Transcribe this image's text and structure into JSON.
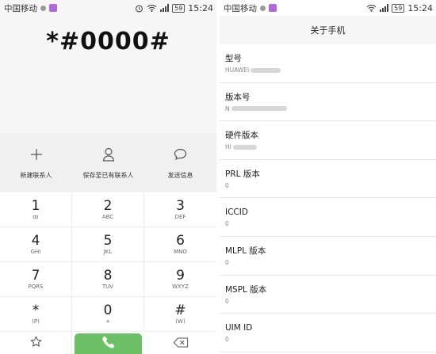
{
  "status_bar": {
    "carrier": "中国移动",
    "battery": "59",
    "time": "15:24"
  },
  "dialer": {
    "input": "*#0000#",
    "actions": [
      {
        "label": "新建联系人",
        "icon": "plus-icon"
      },
      {
        "label": "保存至已有联系人",
        "icon": "person-icon"
      },
      {
        "label": "发送信息",
        "icon": "message-icon"
      }
    ],
    "keys": [
      {
        "digit": "1",
        "letters": "ꝏ"
      },
      {
        "digit": "2",
        "letters": "ABC"
      },
      {
        "digit": "3",
        "letters": "DEF"
      },
      {
        "digit": "4",
        "letters": "GHI"
      },
      {
        "digit": "5",
        "letters": "JKL"
      },
      {
        "digit": "6",
        "letters": "MNO"
      },
      {
        "digit": "7",
        "letters": "PQRS"
      },
      {
        "digit": "8",
        "letters": "TUV"
      },
      {
        "digit": "9",
        "letters": "WXYZ"
      },
      {
        "digit": "*",
        "letters": "(P)"
      },
      {
        "digit": "0",
        "letters": "+"
      },
      {
        "digit": "#",
        "letters": "(W)"
      }
    ],
    "call_color": "#6dc066",
    "bottom_icons": [
      "star-icon",
      "phone-icon",
      "backspace-icon"
    ]
  },
  "about": {
    "title": "关于手机",
    "items": [
      {
        "title": "型号",
        "value": "HUAWEI"
      },
      {
        "title": "版本号",
        "value": "N"
      },
      {
        "title": "硬件版本",
        "value": "HI"
      },
      {
        "title": "PRL 版本",
        "value": "0"
      },
      {
        "title": "ICCID",
        "value": "0"
      },
      {
        "title": "MLPL 版本",
        "value": "0"
      },
      {
        "title": "MSPL 版本",
        "value": "0"
      },
      {
        "title": "UIM ID",
        "value": "0"
      }
    ]
  }
}
